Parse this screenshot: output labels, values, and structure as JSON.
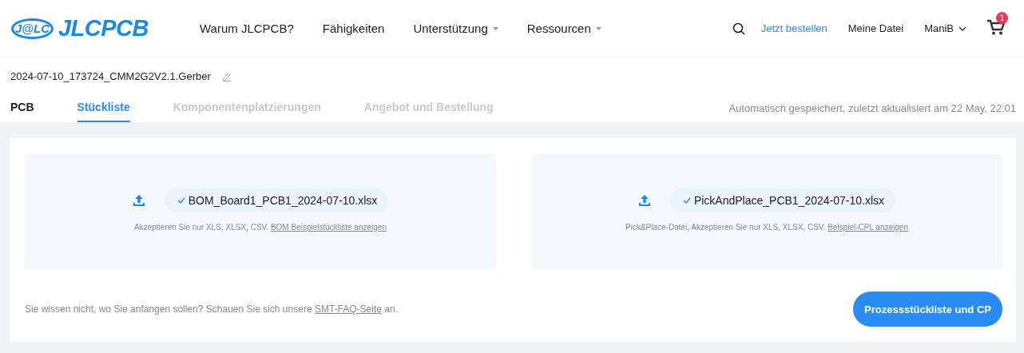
{
  "header": {
    "logo": {
      "badge": "J@LC",
      "name": "JLCPCB"
    },
    "nav": [
      {
        "label": "Warum JLCPCB?",
        "has_menu": false
      },
      {
        "label": "Fähigkeiten",
        "has_menu": false
      },
      {
        "label": "Unterstützung",
        "has_menu": true
      },
      {
        "label": "Ressourcen",
        "has_menu": true
      }
    ],
    "order_link": "Jetzt bestellen",
    "my_files": "Meine Datei",
    "user": "ManiB",
    "cart_count": "1"
  },
  "file_name": "2024-07-10_173724_CMM2G2V2.1.Gerber",
  "tabs": [
    {
      "label": "PCB",
      "selected": false,
      "disabled": false
    },
    {
      "label": "Stückliste",
      "selected": true,
      "disabled": false
    },
    {
      "label": "Komponentenplatzierungen",
      "selected": false,
      "disabled": true
    },
    {
      "label": "Angebot und Bestellung",
      "selected": false,
      "disabled": true
    }
  ],
  "autosave": "Automatisch gespeichert, zuletzt aktualisiert am 22 May, 22:01",
  "uploads": [
    {
      "file": "BOM_Board1_PCB1_2024-07-10.xlsx",
      "uploaded": true,
      "hint": "Akzeptieren Sie nur XLS, XLSX, CSV.",
      "link": "BOM Beispielstückliste anzeigen"
    },
    {
      "file": "PickAndPlace_PCB1_2024-07-10.xlsx",
      "uploaded": true,
      "hint": "Pick&Place-Datei, Akzeptieren Sie nur XLS, XLSX, CSV.",
      "link": "Beispiel-CPL anzeigen"
    }
  ],
  "footer": {
    "text": "Sie wissen nicht, wo Sie anfangen sollen? Schauen Sie sich unsere",
    "link": "SMT-FAQ-Seite",
    "after": "an."
  },
  "process_button": "Prozessstückliste und CP"
}
